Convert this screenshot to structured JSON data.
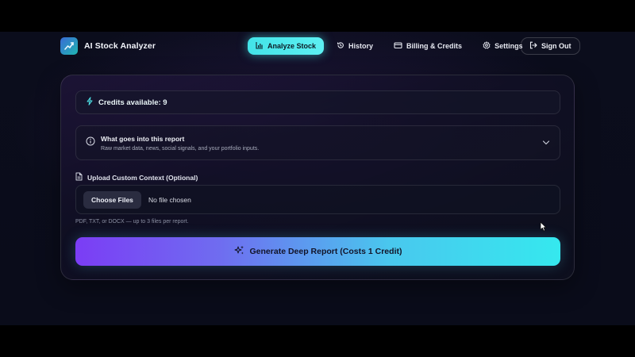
{
  "app": {
    "title": "AI Stock Analyzer",
    "logo_icon": "chart-up-icon"
  },
  "nav": {
    "items": [
      {
        "label": "Analyze Stock",
        "icon": "bar-chart-icon",
        "active": true
      },
      {
        "label": "History",
        "icon": "history-icon",
        "active": false
      },
      {
        "label": "Billing & Credits",
        "icon": "credit-card-icon",
        "active": false
      },
      {
        "label": "Settings",
        "icon": "gear-icon",
        "active": false
      }
    ],
    "signout_label": "Sign Out"
  },
  "credits": {
    "text": "Credits available: 9"
  },
  "report_info": {
    "title": "What goes into this report",
    "subtitle": "Raw market data, news, social signals, and your portfolio inputs."
  },
  "upload": {
    "label": "Upload Custom Context (Optional)",
    "button_label": "Choose Files",
    "status": "No file chosen",
    "hint": "PDF, TXT, or DOCX — up to 3 files per report."
  },
  "generate": {
    "label": "Generate Deep Report (Costs 1 Credit)"
  },
  "colors": {
    "accent_cyan": "#43e3e8",
    "gradient_start": "#7b3df5",
    "gradient_end": "#35e8ee",
    "background": "#0b0d1c"
  }
}
